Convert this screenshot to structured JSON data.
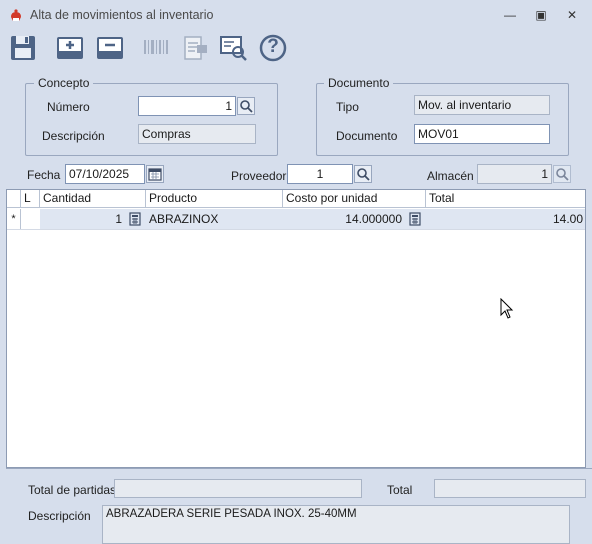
{
  "window": {
    "title": "Alta de movimientos al inventario",
    "controls": {
      "minimize": "—",
      "maximize": "▣",
      "close": "✕"
    }
  },
  "toolbar": {
    "icons": [
      "save-icon",
      "add-row-icon",
      "remove-row-icon",
      "barcode-icon",
      "document-disabled-icon",
      "search-document-icon",
      "help-icon"
    ],
    "help_glyph": "?"
  },
  "concepto": {
    "legend": "Concepto",
    "numero_label": "Número",
    "numero_value": "1",
    "descripcion_label": "Descripción",
    "descripcion_value": "Compras"
  },
  "documento": {
    "legend": "Documento",
    "tipo_label": "Tipo",
    "tipo_value": "Mov. al inventario",
    "documento_label": "Documento",
    "documento_value": "MOV01"
  },
  "header_row": {
    "fecha_label": "Fecha",
    "fecha_value": "07/10/2025",
    "proveedor_label": "Proveedor",
    "proveedor_value": "1",
    "almacen_label": "Almacén",
    "almacen_value": "1"
  },
  "grid": {
    "columns": [
      "L",
      "Cantidad",
      "Producto",
      "Costo por unidad",
      "Total"
    ],
    "rows": [
      {
        "marker": "*",
        "cantidad": "1",
        "producto": "ABRAZINOX",
        "costo": "14.000000",
        "total": "14.00"
      }
    ]
  },
  "footer": {
    "partidas_label": "Total de partidas",
    "partidas_value": "",
    "total_label": "Total",
    "total_value": "",
    "descripcion_label": "Descripción",
    "descripcion_value": "ABRAZADERA SERIE PESADA INOX. 25-40MM"
  },
  "colors": {
    "background": "#d6deec",
    "field_border": "#7f93b4",
    "readonly_field": "#e6eaf0",
    "selected_row": "#dfe6f2",
    "accent_red": "#d23a2a"
  }
}
